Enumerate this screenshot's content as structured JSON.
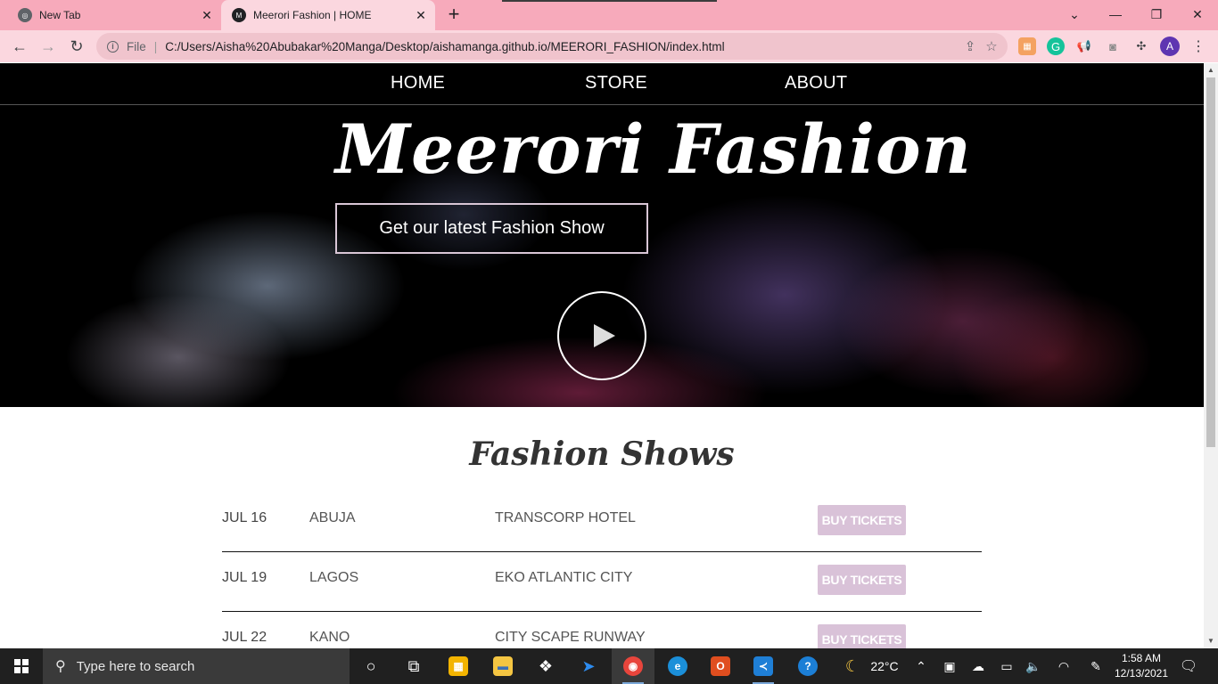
{
  "browser": {
    "tabs": [
      {
        "title": "New Tab",
        "active": false
      },
      {
        "title": "Meerori Fashion | HOME",
        "active": true
      }
    ],
    "newtab_symbol": "+",
    "scheme_label": "File",
    "url": "C:/Users/Aisha%20Abubakar%20Manga/Desktop/aishamanga.github.io/MEERORI_FASHION/index.html",
    "profile_initial": "A"
  },
  "page": {
    "nav": [
      "HOME",
      "STORE",
      "ABOUT"
    ],
    "hero_title": "Meerori Fashion",
    "hero_button": "Get our latest Fashion Show",
    "shows_heading": "Fashion Shows",
    "shows": [
      {
        "date": "JUL 16",
        "city": "ABUJA",
        "venue": "TRANSCORP HOTEL",
        "button": "BUY TICKETS"
      },
      {
        "date": "JUL 19",
        "city": "LAGOS",
        "venue": "EKO ATLANTIC CITY",
        "button": "BUY TICKETS"
      },
      {
        "date": "JUL 22",
        "city": "KANO",
        "venue": "CITY SCAPE RUNWAY",
        "button": "BUY TICKETS"
      }
    ],
    "colors": {
      "button_bg": "#d9c2d8",
      "hero_bg": "#000000"
    }
  },
  "taskbar": {
    "search_placeholder": "Type here to search",
    "temperature": "22°C",
    "time": "1:58 AM",
    "date": "12/13/2021"
  }
}
